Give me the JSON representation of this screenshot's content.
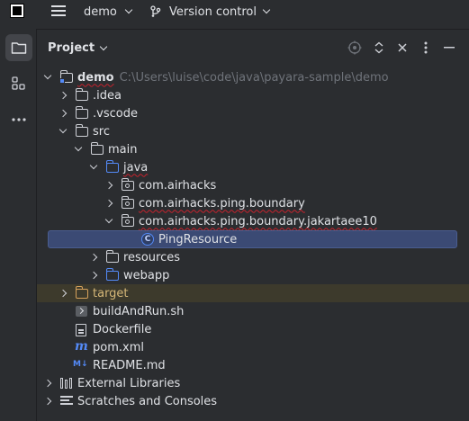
{
  "titlebar": {
    "project_name": "demo",
    "vcs_label": "Version control"
  },
  "panel": {
    "title": "Project"
  },
  "tree": {
    "root_name": "demo",
    "root_path": "C:\\Users\\luise\\code\\java\\payara-sample\\demo",
    "idea": ".idea",
    "vscode": ".vscode",
    "src": "src",
    "main": "main",
    "java": "java",
    "pkg1": "com.airhacks",
    "pkg2": "com.airhacks.ping.boundary",
    "pkg3": "com.airhacks.ping.boundary.jakartaee10",
    "class1": "PingResource",
    "resources": "resources",
    "webapp": "webapp",
    "target": "target",
    "build_script": "buildAndRun.sh",
    "dockerfile": "Dockerfile",
    "pom": "pom.xml",
    "readme": "README.md",
    "external_libraries": "External Libraries",
    "scratches": "Scratches and Consoles"
  },
  "icons": {
    "class_letter": "C",
    "maven_letter": "m",
    "markdown_badge": "M↓"
  },
  "colors": {
    "background": "#2b2d30",
    "selection": "#3b4a74",
    "excluded_row": "#3d3a2c",
    "accent_blue": "#548af7",
    "target_folder": "#d5a15b"
  }
}
